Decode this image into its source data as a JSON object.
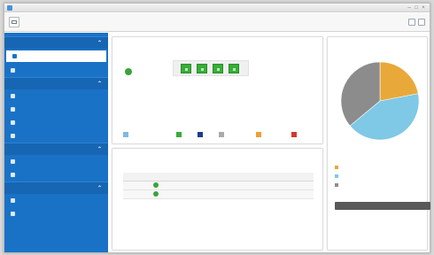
{
  "window": {
    "title": "",
    "controls": {
      "minimize": "–",
      "maximize": "□",
      "close": "×"
    }
  },
  "sidebar": {
    "sections": [
      {
        "label": "",
        "items": [
          {
            "label": "",
            "active": true
          },
          {
            "label": ""
          }
        ]
      },
      {
        "label": "",
        "items": [
          {
            "label": ""
          },
          {
            "label": ""
          },
          {
            "label": ""
          },
          {
            "label": ""
          }
        ]
      },
      {
        "label": "",
        "items": [
          {
            "label": ""
          },
          {
            "label": ""
          }
        ]
      },
      {
        "label": "",
        "items": [
          {
            "label": ""
          },
          {
            "label": ""
          }
        ]
      }
    ],
    "caret": "⌃"
  },
  "system_panel": {
    "title": "",
    "status_label": "",
    "disk_count": 4,
    "legend": [
      {
        "label": "",
        "color": "#7fb8e6"
      },
      {
        "label": "",
        "color": "#38ad38"
      },
      {
        "label": "",
        "color": "#1a3c8c"
      },
      {
        "label": "",
        "color": "#aaaaaa"
      },
      {
        "label": "",
        "color": "#f0a030"
      },
      {
        "label": "",
        "color": "#d23a2a"
      }
    ]
  },
  "volume_panel": {
    "title": "",
    "columns": [
      "",
      "",
      "",
      "",
      ""
    ],
    "rows": [
      [
        "",
        "",
        "",
        "",
        ""
      ],
      [
        "",
        "",
        "",
        "",
        ""
      ]
    ]
  },
  "storage_panel": {
    "title": "",
    "pie_caption": "",
    "pie": [
      {
        "label": "",
        "fraction": 0.22,
        "color": "#e8a93a"
      },
      {
        "label": "",
        "fraction": 0.42,
        "color": "#7fc8e6"
      },
      {
        "label": "",
        "fraction": 0.36,
        "color": "#8c8c8c"
      }
    ],
    "rows": [
      {
        "label": "",
        "value": "",
        "color": "#e8a93a"
      },
      {
        "label": "",
        "value": "",
        "color": "#7fc8e6"
      },
      {
        "label": "",
        "value": "",
        "color": "#8c8c8c"
      }
    ],
    "manage_button": ""
  }
}
